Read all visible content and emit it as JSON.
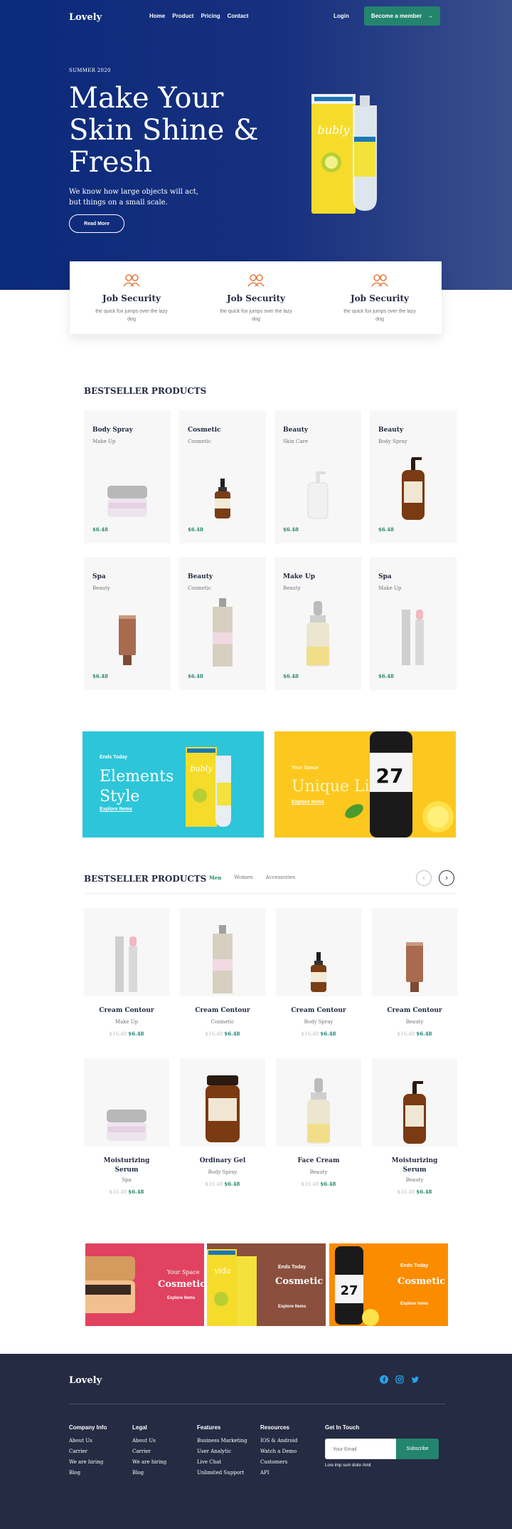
{
  "nav": {
    "logo": "Lovely",
    "links": [
      "Home",
      "Product",
      "Pricing",
      "Contact"
    ],
    "login": "Login",
    "cta": "Become a member"
  },
  "hero": {
    "eyebrow": "SUMMER 2020",
    "title": "Make Your Skin Shine & Fresh",
    "subtitle": "We know how large objects will act, but things on a small scale.",
    "button": "Read More"
  },
  "features": [
    {
      "title": "Job Security",
      "desc": "the quick fox jumps over the lazy dog",
      "icon": "users-icon"
    },
    {
      "title": "Job Security",
      "desc": "the quick fox jumps over the lazy dog",
      "icon": "users-icon"
    },
    {
      "title": "Job Security",
      "desc": "the quick fox jumps over the lazy dog",
      "icon": "users-icon"
    }
  ],
  "bestseller1": {
    "title": "BESTSELLER PRODUCTS",
    "items": [
      {
        "name": "Body Spray",
        "category": "Make Up",
        "price": "$6.48",
        "product": "jar"
      },
      {
        "name": "Cosmetic",
        "category": "Cosmetic",
        "price": "$6.48",
        "product": "dropper"
      },
      {
        "name": "Beauty",
        "category": "Skin Care",
        "price": "$6.48",
        "product": "pump-white"
      },
      {
        "name": "Beauty",
        "category": "Body Spray",
        "price": "$6.48",
        "product": "pump-amber"
      },
      {
        "name": "Spa",
        "category": "Beauty",
        "price": "$6.48",
        "product": "tube"
      },
      {
        "name": "Beauty",
        "category": "Cosmetic",
        "price": "$6.48",
        "product": "spray"
      },
      {
        "name": "Make Up",
        "category": "Beauty",
        "price": "$6.48",
        "product": "dropper-big"
      },
      {
        "name": "Spa",
        "category": "Make Up",
        "price": "$6.48",
        "product": "lipstick"
      }
    ]
  },
  "promos": [
    {
      "tag": "Ends Today",
      "title": "Elements Style",
      "link": "Explore Items",
      "color": "#2dc5d9"
    },
    {
      "tag": "Your Space",
      "title": "Unique Life",
      "link": "Explore Items",
      "color": "#fcc71f"
    }
  ],
  "bestseller2": {
    "title": "BESTSELLER PRODUCTS",
    "tabs": [
      "Men",
      "Women",
      "Accessories"
    ],
    "items": [
      {
        "name": "Cream Contour",
        "category": "Make Up",
        "old": "$16.48",
        "price": "$6.48",
        "product": "lipstick"
      },
      {
        "name": "Cream Contour",
        "category": "Cosmetic",
        "old": "$16.48",
        "price": "$6.48",
        "product": "spray"
      },
      {
        "name": "Cream Contour",
        "category": "Body Spray",
        "old": "$16.48",
        "price": "$6.48",
        "product": "dropper"
      },
      {
        "name": "Cream Contour",
        "category": "Beauty",
        "old": "$16.48",
        "price": "$6.48",
        "product": "tube"
      },
      {
        "name": "Moisturizing Serum",
        "category": "Spa",
        "old": "$16.48",
        "price": "$6.48",
        "product": "jar"
      },
      {
        "name": "Ordinary Gel",
        "category": "Body Spray",
        "old": "$16.48",
        "price": "$6.48",
        "product": "amber-jar"
      },
      {
        "name": "Face Cream",
        "category": "Beauty",
        "old": "$16.48",
        "price": "$6.48",
        "product": "dropper-big"
      },
      {
        "name": "Moisturizing Serum",
        "category": "Beauty",
        "old": "$16.48",
        "price": "$6.48",
        "product": "pump-amber"
      }
    ]
  },
  "banners": [
    {
      "tag": "Your Space",
      "title": "Cosmetic",
      "link": "Explore Items",
      "color": "#e0425f"
    },
    {
      "tag": "Ends Today",
      "title": "Cosmetic",
      "link": "Explore Items",
      "color": "#8a4f3d"
    },
    {
      "tag": "Ends Today",
      "title": "Cosmetic",
      "link": "Explore Items",
      "color": "#fb8c00"
    }
  ],
  "footer": {
    "logo": "Lovely",
    "social": [
      "facebook-icon",
      "instagram-icon",
      "twitter-icon"
    ],
    "columns": [
      {
        "title": "Company Info",
        "links": [
          "About Us",
          "Carrier",
          "We are hiring",
          "Blog"
        ]
      },
      {
        "title": "Legal",
        "links": [
          "About Us",
          "Carrier",
          "We are hiring",
          "Blog"
        ]
      },
      {
        "title": "Features",
        "links": [
          "Business Marketing",
          "User Analytic",
          "Live Chat",
          "Unlimited Support"
        ]
      },
      {
        "title": "Resources",
        "links": [
          "IOS & Android",
          "Watch a Demo",
          "Customers",
          "API"
        ]
      }
    ],
    "touch_title": "Get In Touch",
    "email_placeholder": "Your Email",
    "subscribe": "Subscribe",
    "touch_note": "Lore imp sum dolor Amit"
  }
}
